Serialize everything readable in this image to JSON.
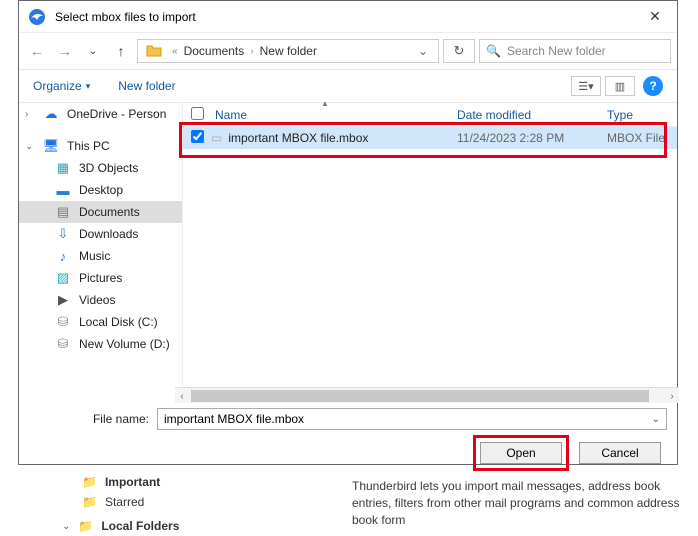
{
  "titlebar": {
    "title": "Select mbox files to import"
  },
  "nav": {
    "path_prefix": "«",
    "crumb1": "Documents",
    "crumb2": "New folder",
    "search_placeholder": "Search New folder"
  },
  "toolbar": {
    "organize": "Organize",
    "new_folder": "New folder"
  },
  "sidebar": {
    "onedrive": "OneDrive - Person",
    "thispc": "This PC",
    "items": [
      {
        "label": "3D Objects",
        "icon": "ico-3d"
      },
      {
        "label": "Desktop",
        "icon": "ico-desk"
      },
      {
        "label": "Documents",
        "icon": "ico-doc",
        "selected": true
      },
      {
        "label": "Downloads",
        "icon": "ico-dl"
      },
      {
        "label": "Music",
        "icon": "ico-music"
      },
      {
        "label": "Pictures",
        "icon": "ico-pic"
      },
      {
        "label": "Videos",
        "icon": "ico-vid"
      },
      {
        "label": "Local Disk (C:)",
        "icon": "ico-disk"
      },
      {
        "label": "New Volume (D:)",
        "icon": "ico-disk"
      }
    ]
  },
  "columns": {
    "name": "Name",
    "date": "Date modified",
    "type": "Type"
  },
  "files": [
    {
      "name": "important MBOX file.mbox",
      "date": "11/24/2023 2:28 PM",
      "type": "MBOX File",
      "checked": true
    }
  ],
  "filename": {
    "label": "File name:",
    "value": "important MBOX file.mbox"
  },
  "buttons": {
    "open": "Open",
    "cancel": "Cancel"
  },
  "background": {
    "tree_important": "Important",
    "tree_starred": "Starred",
    "tree_local": "Local Folders",
    "note": "Thunderbird lets you import mail messages, address book entries, filters from other mail programs and common address book form"
  }
}
